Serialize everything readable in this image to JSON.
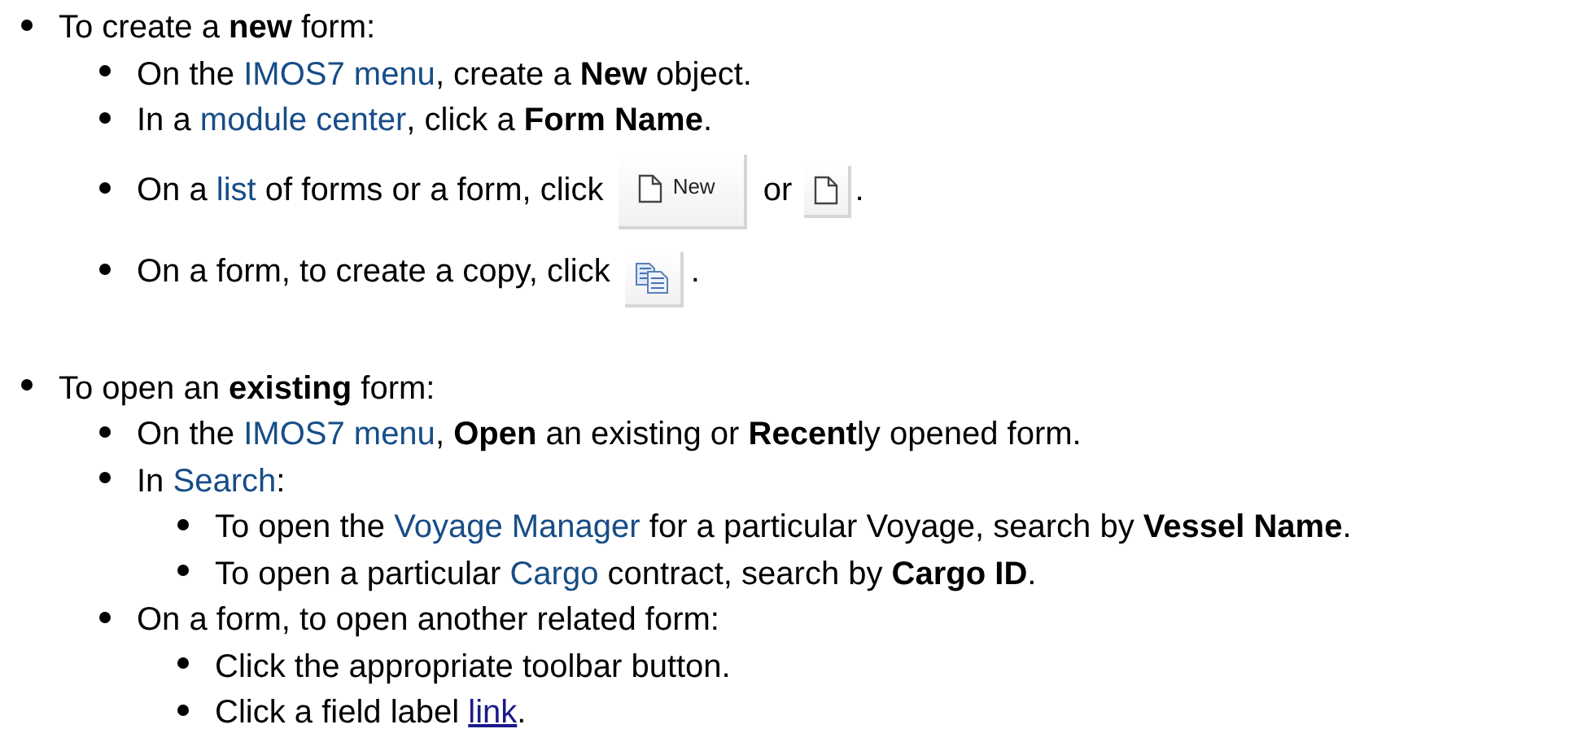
{
  "items": [
    {
      "segments": [
        {
          "kind": "text",
          "text": "To create a **new** form:"
        }
      ],
      "children": [
        {
          "segments": [
            {
              "kind": "text",
              "text": "On the "
            },
            {
              "kind": "link",
              "text": "IMOS7 menu"
            },
            {
              "kind": "text",
              "text": ", create a **New** object."
            }
          ]
        },
        {
          "segments": [
            {
              "kind": "text",
              "text": "In a "
            },
            {
              "kind": "link",
              "text": "module center"
            },
            {
              "kind": "text",
              "text": ", click a **Form Name**."
            }
          ]
        },
        {
          "segments": [
            {
              "kind": "text",
              "text": "On a "
            },
            {
              "kind": "link",
              "text": "list"
            },
            {
              "kind": "text",
              "text": " of forms or a form, click "
            },
            {
              "kind": "labelbutton",
              "text": "New"
            },
            {
              "kind": "text",
              "text": " or "
            },
            {
              "kind": "pagebutton"
            },
            {
              "kind": "text",
              "text": "."
            }
          ]
        },
        {
          "segments": [
            {
              "kind": "text",
              "text": "On a form, to create a copy, click "
            },
            {
              "kind": "copybutton"
            },
            {
              "kind": "text",
              "text": "."
            }
          ]
        }
      ]
    },
    {
      "segments": [
        {
          "kind": "text",
          "text": "To open an **existing** form:"
        }
      ],
      "children": [
        {
          "segments": [
            {
              "kind": "text",
              "text": "On the "
            },
            {
              "kind": "link",
              "text": "IMOS7 menu"
            },
            {
              "kind": "text",
              "text": ", **Open** an existing or **Recent**ly opened form."
            }
          ]
        },
        {
          "segments": [
            {
              "kind": "text",
              "text": "In "
            },
            {
              "kind": "link",
              "text": "Search"
            },
            {
              "kind": "text",
              "text": ":"
            }
          ],
          "children": [
            {
              "segments": [
                {
                  "kind": "text",
                  "text": "To open the "
                },
                {
                  "kind": "link",
                  "text": "Voyage Manager"
                },
                {
                  "kind": "text",
                  "text": " for a particular Voyage, search by **Vessel Name**."
                }
              ]
            },
            {
              "segments": [
                {
                  "kind": "text",
                  "text": "To open a particular "
                },
                {
                  "kind": "link",
                  "text": "Cargo"
                },
                {
                  "kind": "text",
                  "text": " contract, search by **Cargo ID**."
                }
              ]
            }
          ]
        },
        {
          "segments": [
            {
              "kind": "text",
              "text": "On a form, to open another related form:"
            }
          ],
          "children": [
            {
              "segments": [
                {
                  "kind": "text",
                  "text": "Click the appropriate toolbar button."
                }
              ]
            },
            {
              "segments": [
                {
                  "kind": "text",
                  "text": "Click a field label "
                },
                {
                  "kind": "anchor",
                  "text": "link"
                },
                {
                  "kind": "text",
                  "text": "."
                }
              ]
            }
          ]
        }
      ]
    }
  ]
}
